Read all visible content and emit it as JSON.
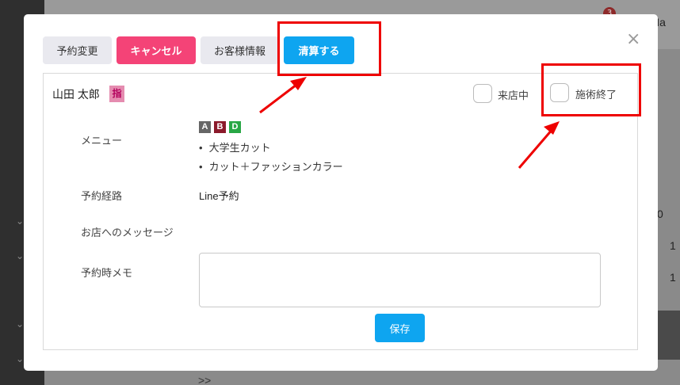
{
  "background": {
    "notification_count": "3",
    "user_name_partial": "Ha",
    "cell_values": [
      "0",
      "1",
      "1"
    ],
    "pager": ">>"
  },
  "modal": {
    "close_glyph": "×",
    "tabs": {
      "change": "予約変更",
      "cancel": "キャンセル",
      "info": "お客様情報",
      "pay": "清算する"
    },
    "customer_name": "山田 太郎",
    "nomination_badge": "指",
    "status": {
      "in_store": "来店中",
      "finished": "施術終了"
    },
    "labels": {
      "menu": "メニュー",
      "route": "予約経路",
      "message": "お店へのメッセージ",
      "memo": "予約時メモ"
    },
    "menu_badges": [
      {
        "letter": "A",
        "color": "#666666"
      },
      {
        "letter": "B",
        "color": "#8b1a2b"
      },
      {
        "letter": "D",
        "color": "#28a745"
      }
    ],
    "menu_items": [
      "大学生カット",
      "カット＋ファッションカラー"
    ],
    "route_value": "Line予約",
    "memo_value": "",
    "save_label": "保存"
  },
  "annotation_color": "#ee0000"
}
